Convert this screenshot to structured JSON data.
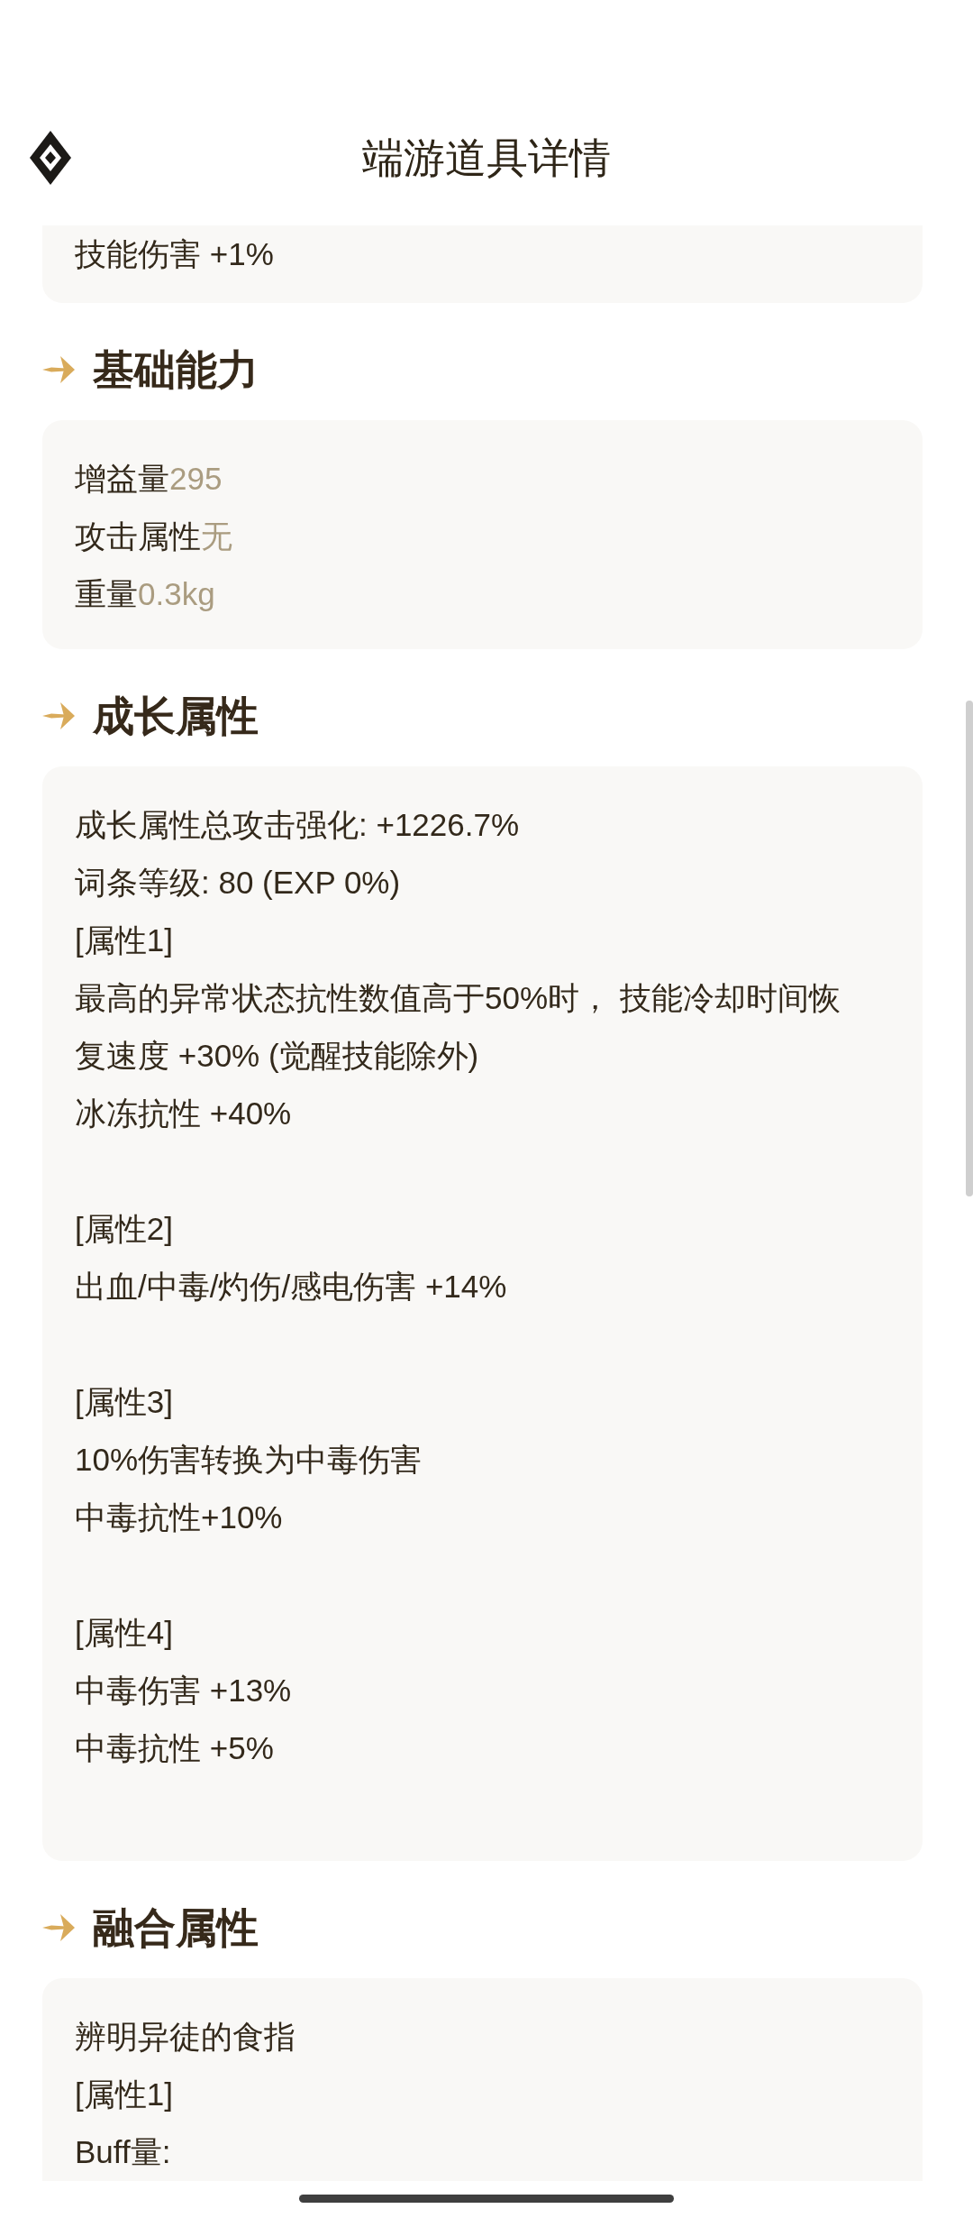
{
  "header": {
    "title": "端游道具详情"
  },
  "sections": [
    {
      "kind": "text",
      "blocks": [
        [
          "技能伤害 +1%"
        ]
      ]
    },
    {
      "kind": "stats",
      "heading": "基础能力",
      "stats": [
        {
          "label": "增益量",
          "value": "295"
        },
        {
          "label": "攻击属性",
          "value": "无"
        },
        {
          "label": "重量",
          "value": "0.3kg"
        }
      ]
    },
    {
      "kind": "text",
      "heading": "成长属性",
      "blocks": [
        [
          "成长属性总攻击强化: +1226.7%",
          "词条等级: 80 (EXP 0%)",
          "[属性1]",
          "最高的异常状态抗性数值高于50%时， 技能冷却时间恢复速度 +30% (觉醒技能除外)",
          "冰冻抗性 +40%"
        ],
        [
          "[属性2]",
          "出血/中毒/灼伤/感电伤害 +14%"
        ],
        [
          "[属性3]",
          "10%伤害转换为中毒伤害",
          "中毒抗性+10%"
        ],
        [
          "[属性4]",
          "中毒伤害 +13%",
          "中毒抗性 +5%"
        ]
      ]
    },
    {
      "kind": "text",
      "heading": "融合属性",
      "blocks": [
        [
          "辨明异徒的食指",
          "[属性1]",
          "Buff量:"
        ]
      ]
    }
  ]
}
